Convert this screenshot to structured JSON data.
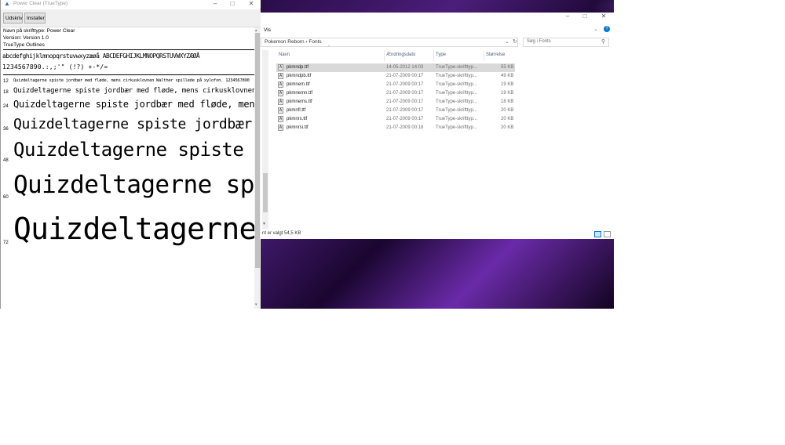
{
  "font_viewer": {
    "title": "Power Clear (TrueType)",
    "toolbar": {
      "print_label": "Udskriv",
      "install_label": "Installer"
    },
    "font_name_line": "Navn på skrifttype: Power Clear",
    "version_line": "Version: Version 1.0",
    "format_line": "TrueType Outlines",
    "charset_line1": "abcdefghijklmnopqrstuvwxyzæøå ABCDEFGHIJKLMNOPQRSTUVWXYZÆØÅ",
    "charset_line2": "1234567890.:,;'\" (!?) +-*/=",
    "samples": [
      {
        "size": "12",
        "text": "Quizdeltagerne spiste jordbær med fløde, mens cirkusklovnen Walther spillede på xylofon. 1234567890"
      },
      {
        "size": "18",
        "text": "Quizdeltagerne spiste jordbær med fløde, mens cirkusklovnen"
      },
      {
        "size": "24",
        "text": "Quizdeltagerne spiste jordbær med fløde, mens"
      },
      {
        "size": "36",
        "text": "Quizdeltagerne spiste jordbær"
      },
      {
        "size": "48",
        "text": "Quizdeltagerne spiste jor"
      },
      {
        "size": "60",
        "text": "Quizdeltagerne spis"
      },
      {
        "size": "72",
        "text": "Quizdeltagerne"
      }
    ]
  },
  "explorer": {
    "menu": {
      "view_label": "Vis"
    },
    "breadcrumb": {
      "parent": "Pokemon Reborn",
      "sep": "›",
      "current": "Fonts"
    },
    "search_placeholder": "Søg i Fonts",
    "columns": {
      "name": "Navn",
      "date": "Ændringsdato",
      "type": "Type",
      "size": "Størrelse"
    },
    "files": [
      {
        "name": "pkmndp.ttf",
        "date": "14-05-2012 14:03",
        "type": "TrueType-skrifttyp...",
        "size": "55 KB"
      },
      {
        "name": "pkmndpb.ttf",
        "date": "21-07-2009 00:17",
        "type": "TrueType-skrifttyp...",
        "size": "49 KB"
      },
      {
        "name": "pkmnem.ttf",
        "date": "21-07-2009 00:17",
        "type": "TrueType-skrifttyp...",
        "size": "19 KB"
      },
      {
        "name": "pkmnemn.ttf",
        "date": "21-07-2009 00:17",
        "type": "TrueType-skrifttyp...",
        "size": "19 KB"
      },
      {
        "name": "pkmnems.ttf",
        "date": "21-07-2009 00:17",
        "type": "TrueType-skrifttyp...",
        "size": "18 KB"
      },
      {
        "name": "pkmnfl.ttf",
        "date": "21-07-2009 00:17",
        "type": "TrueType-skrifttyp...",
        "size": "20 KB"
      },
      {
        "name": "pkmnrs.ttf",
        "date": "21-07-2009 00:17",
        "type": "TrueType-skrifttyp...",
        "size": "20 KB"
      },
      {
        "name": "pkmnrsi.ttf",
        "date": "21-07-2009 00:18",
        "type": "TrueType-skrifttyp...",
        "size": "20 KB"
      }
    ],
    "status": "nt er valgt  54,5 KB"
  },
  "colors": {
    "wallpaper_main": "#4b1e7a",
    "selection": "#d9d9d9",
    "accent": "#0078d7"
  }
}
